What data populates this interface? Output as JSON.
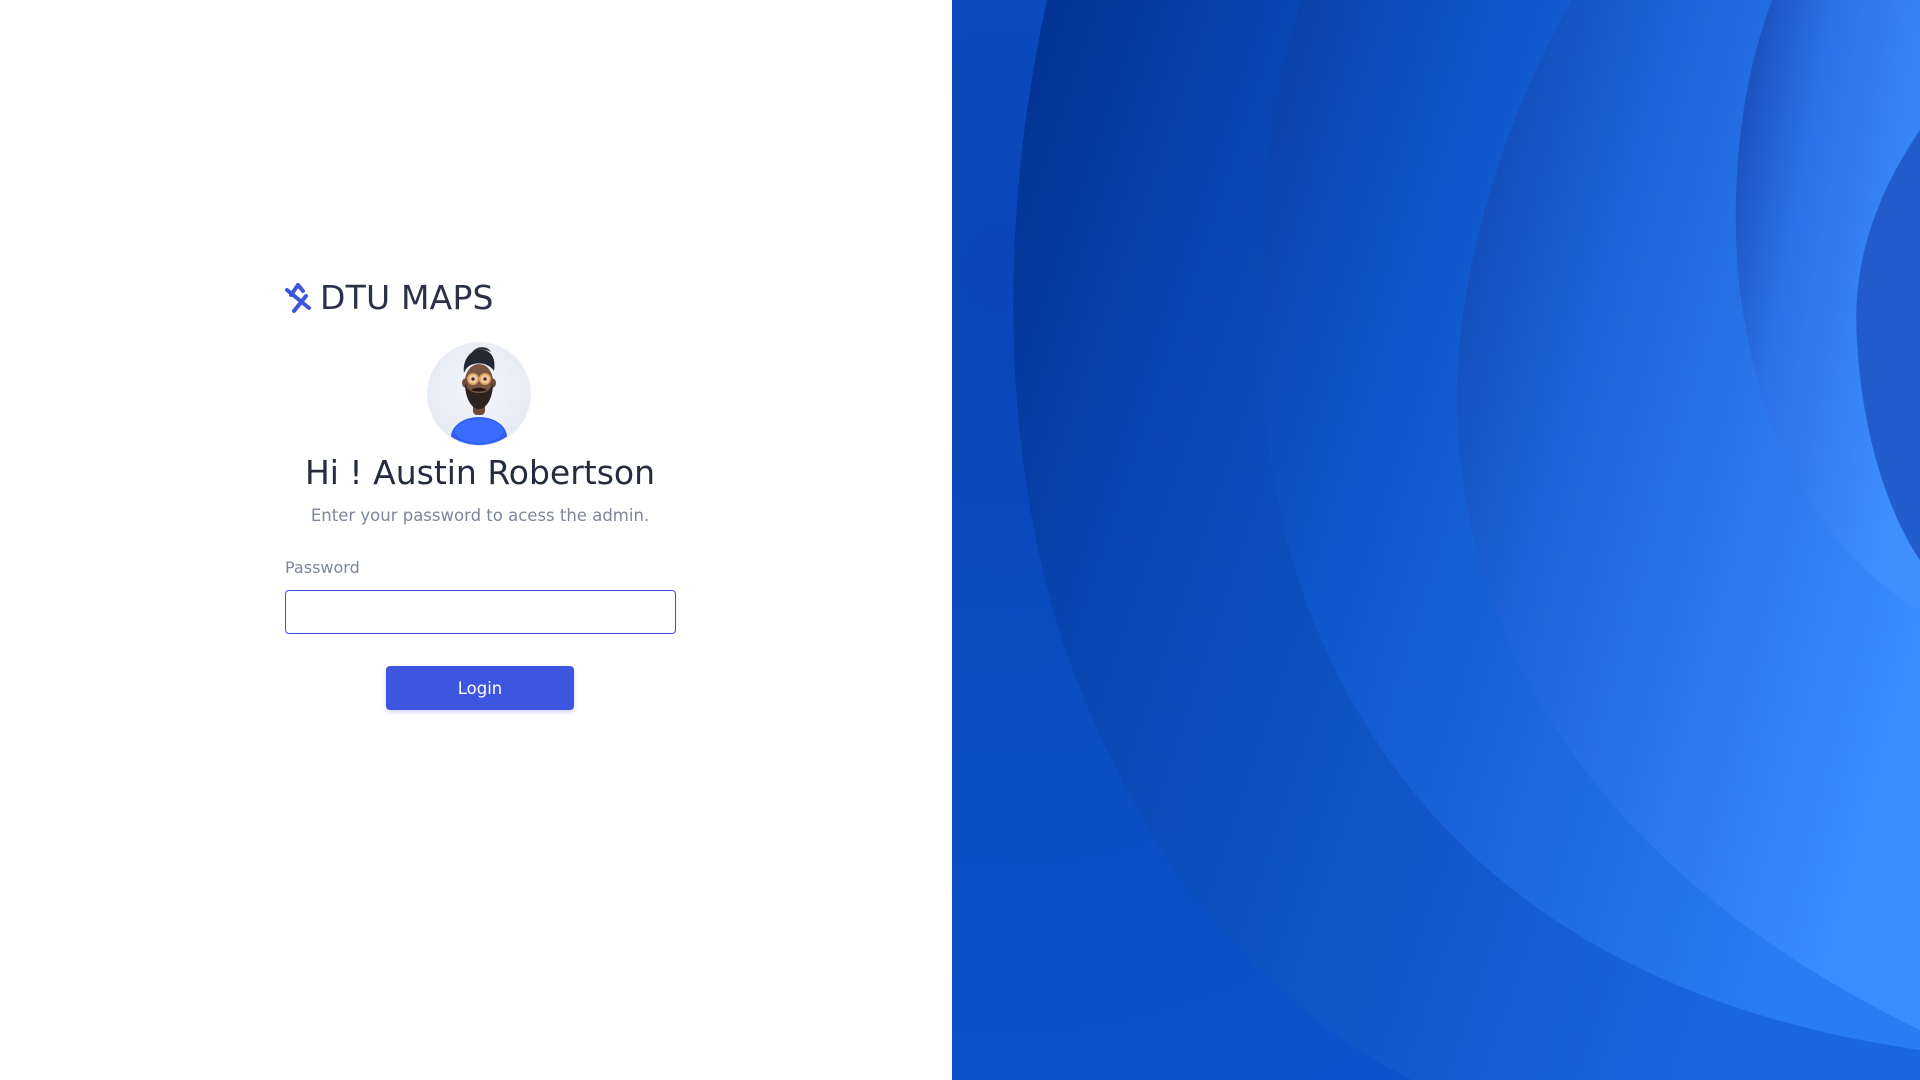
{
  "brand": {
    "name": "DTU MAPS",
    "logo_icon": "dtu-maps-logo-icon",
    "color": "#3e55e0"
  },
  "avatar": {
    "icon": "user-avatar-bearded-man-icon"
  },
  "login": {
    "greeting": "Hi ! Austin Robertson",
    "subtitle": "Enter your password to acess the admin.",
    "password_label": "Password",
    "password_value": "",
    "button_label": "Login"
  },
  "theme": {
    "accent": "#3e55e0",
    "input_border": "#3b4fd8",
    "heading_text": "#252c3f",
    "muted_text": "#7c869c",
    "background_blue": "#0047b3"
  }
}
